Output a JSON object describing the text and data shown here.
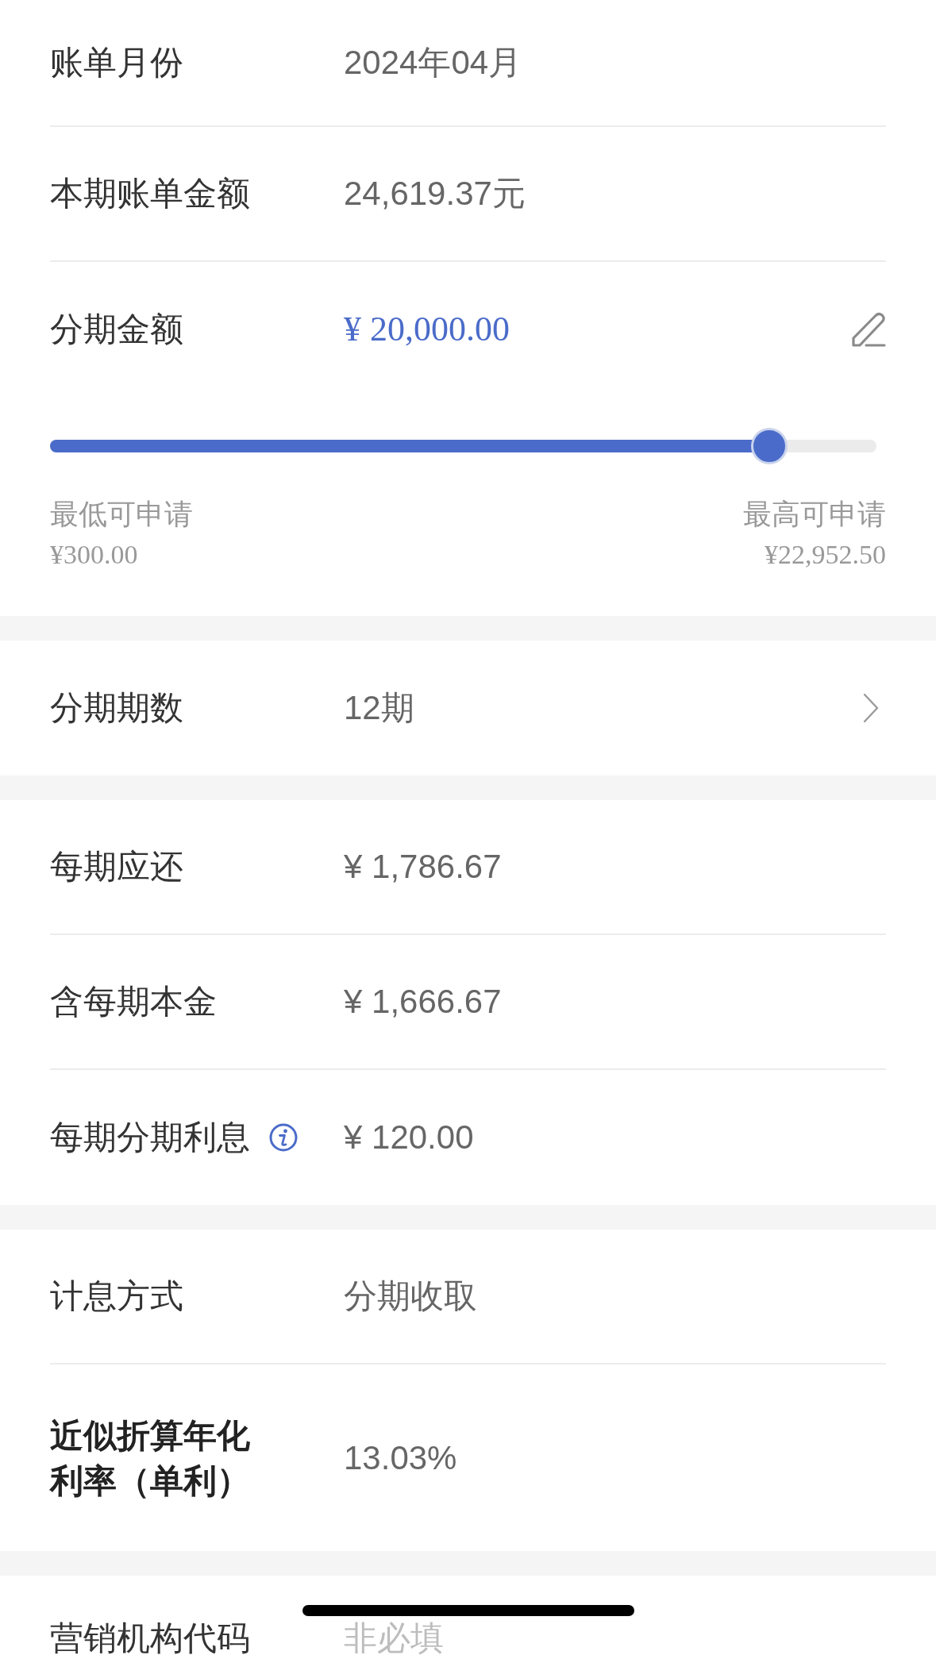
{
  "sections": [
    {
      "rows": [
        {
          "kind": "text",
          "label": "账单月份",
          "value": "2024年04月"
        },
        {
          "kind": "text",
          "label": "本期账单金额",
          "value": "24,619.37元"
        },
        {
          "kind": "amount",
          "label": "分期金额",
          "value": "¥ 20,000.00",
          "slider": {
            "level": 0.87,
            "min": {
              "label": "最低可申请",
              "value": "¥300.00"
            },
            "max": {
              "label": "最高可申请",
              "value": "¥22,952.50"
            }
          }
        }
      ]
    },
    {
      "rows": [
        {
          "kind": "select",
          "label": "分期期数",
          "value": "12期"
        }
      ]
    },
    {
      "rows": [
        {
          "kind": "text",
          "label": "每期应还",
          "value": "¥ 1,786.67"
        },
        {
          "kind": "text",
          "label": "含每期本金",
          "value": "¥ 1,666.67"
        },
        {
          "kind": "info",
          "label": "每期分期利息",
          "value": "¥ 120.00"
        }
      ]
    },
    {
      "rows": [
        {
          "kind": "text",
          "label": "计息方式",
          "value": "分期收取"
        },
        {
          "kind": "emphasis",
          "label": "近似折算年化利率（单利）",
          "value": "13.03%"
        }
      ]
    },
    {
      "rows": [
        {
          "kind": "input",
          "label": "营销机构代码",
          "placeholder": "非必填"
        }
      ]
    }
  ]
}
